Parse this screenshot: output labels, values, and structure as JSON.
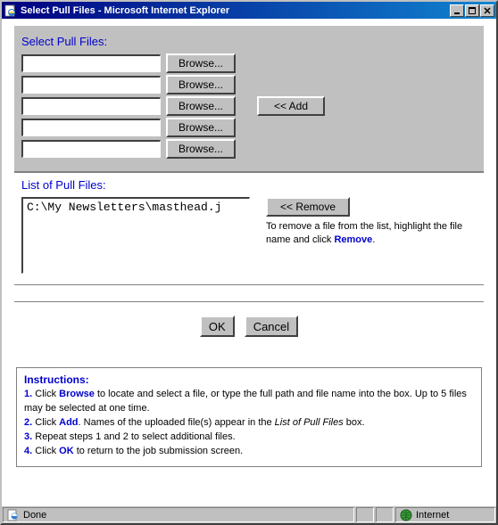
{
  "window": {
    "title": "Select Pull Files - Microsoft Internet Explorer"
  },
  "section1": {
    "title": "Select Pull Files:",
    "files": [
      "",
      "",
      "",
      "",
      ""
    ],
    "browse_label": "Browse...",
    "add_label": "<< Add"
  },
  "section2": {
    "title": "List of Pull Files:",
    "items": [
      "C:\\My Newsletters\\masthead.j"
    ],
    "remove_label": "<< Remove",
    "help_pre": "To remove a file from the list, highlight the file name and click ",
    "help_kw": "Remove",
    "help_post": "."
  },
  "actions": {
    "ok": "OK",
    "cancel": "Cancel"
  },
  "instructions": {
    "title": "Instructions:",
    "l1_a": "1.",
    "l1_b": " Click ",
    "l1_kw": "Browse",
    "l1_c": " to locate and select a file, or type the full path and file name into the box. Up to 5 files may be selected at one time.",
    "l2_a": "2.",
    "l2_b": " Click ",
    "l2_kw": "Add",
    "l2_c": ". Names of the uploaded file(s) appear in the ",
    "l2_ital": "List of Pull Files",
    "l2_d": " box.",
    "l3_a": "3.",
    "l3_b": " Repeat steps 1 and 2 to select additional files.",
    "l4_a": "4.",
    "l4_b": " Click ",
    "l4_kw": "OK",
    "l4_c": " to return to the job submission screen."
  },
  "statusbar": {
    "status": "Done",
    "zone": "Internet"
  }
}
